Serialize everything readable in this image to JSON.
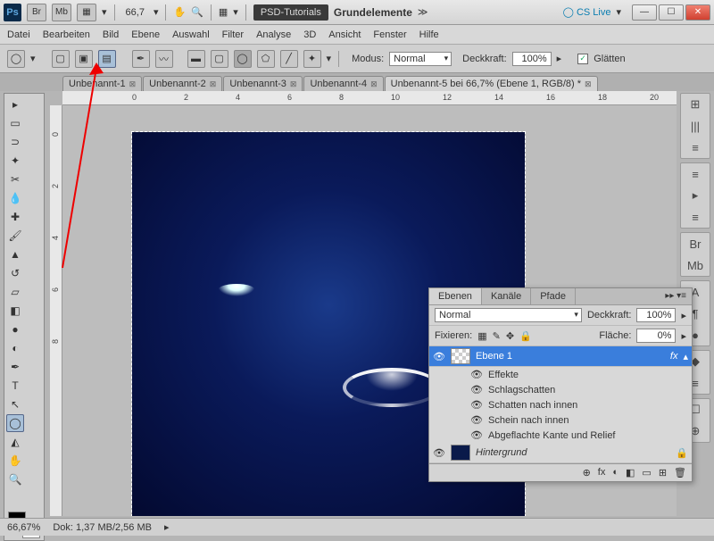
{
  "title": {
    "zoom": "66,7",
    "psd": "PSD-Tutorials",
    "grund": "Grundelemente",
    "cslive": "CS Live"
  },
  "menu": [
    "Datei",
    "Bearbeiten",
    "Bild",
    "Ebene",
    "Auswahl",
    "Filter",
    "Analyse",
    "3D",
    "Ansicht",
    "Fenster",
    "Hilfe"
  ],
  "optbar": {
    "modus_lbl": "Modus:",
    "modus_val": "Normal",
    "deck_lbl": "Deckkraft:",
    "deck_val": "100%",
    "glatten": "Glätten"
  },
  "tabs": [
    {
      "label": "Unbenannt-1"
    },
    {
      "label": "Unbenannt-2"
    },
    {
      "label": "Unbenannt-3"
    },
    {
      "label": "Unbenannt-4"
    },
    {
      "label": "Unbenannt-5 bei 66,7% (Ebene 1, RGB/8) *",
      "active": true
    }
  ],
  "ruler_h": [
    "0",
    "2",
    "4",
    "6",
    "8",
    "10",
    "12",
    "14",
    "16",
    "18",
    "20"
  ],
  "ruler_v": [
    "0",
    "2",
    "4",
    "6",
    "8"
  ],
  "status": {
    "zoom": "66,67%",
    "doc": "Dok: 1,37 MB/2,56 MB"
  },
  "layers": {
    "tabs": [
      "Ebenen",
      "Kanäle",
      "Pfade"
    ],
    "blend": "Normal",
    "deck_lbl": "Deckkraft:",
    "deck_val": "100%",
    "fix_lbl": "Fixieren:",
    "fill_lbl": "Fläche:",
    "fill_val": "0%",
    "items": [
      {
        "name": "Ebene 1",
        "sel": true,
        "fx": "fx"
      },
      {
        "name": "Effekte"
      },
      {
        "name": "Schlagschatten"
      },
      {
        "name": "Schatten nach innen"
      },
      {
        "name": "Schein nach innen"
      },
      {
        "name": "Abgeflachte Kante und Relief"
      },
      {
        "name": "Hintergrund",
        "locked": true
      }
    ],
    "foot": [
      "⊕",
      "fx",
      "◐",
      "◧",
      "▭",
      "⊞",
      "🗑"
    ]
  },
  "tb_btns": [
    "Br",
    "Mb",
    "▦"
  ],
  "right_panel": [
    [
      "⊞",
      "|||",
      "≡"
    ],
    [
      "≡",
      "▸",
      "≡"
    ],
    [
      "Br",
      "Mb"
    ],
    [
      "A",
      "¶",
      "●"
    ],
    [
      "◆",
      "≡"
    ],
    [
      "☐",
      "⊕"
    ]
  ]
}
